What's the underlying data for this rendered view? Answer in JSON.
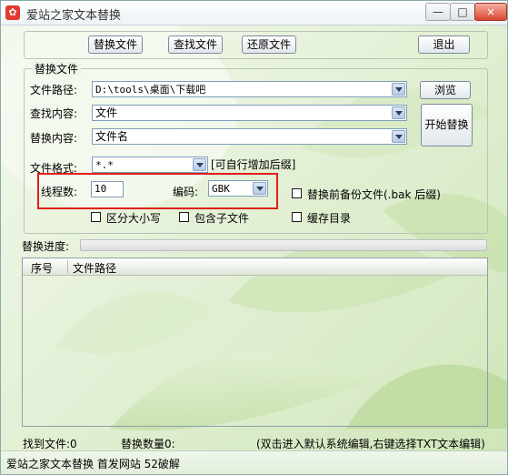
{
  "window": {
    "title": "爱站之家文本替换",
    "minimize": "—",
    "maximize": "□",
    "close": "×"
  },
  "toolbar": {
    "replace": "替换文件",
    "find": "查找文件",
    "restore": "还原文件",
    "exit": "退出"
  },
  "replace_group": {
    "legend": "替换文件",
    "path_label": "文件路径:",
    "path_value": "D:\\tools\\桌面\\下载吧",
    "browse": "浏览",
    "find_label": "查找内容:",
    "find_value": "文件",
    "replace_label": "替换内容:",
    "replace_value": "文件名",
    "start": "开始替换",
    "format_label": "文件格式:",
    "format_value": "*.*",
    "format_hint": "[可自行增加后缀]",
    "threads_label": "线程数:",
    "threads_value": "10",
    "encoding_label": "编码:",
    "encoding_value": "GBK",
    "backup_label": "替换前备份文件(.bak 后缀)",
    "case_label": "区分大小写",
    "subfolder_label": "包含子文件",
    "cache_label": "缓存目录"
  },
  "progress": {
    "label": "替换进度:",
    "value": 0
  },
  "list": {
    "col_num": "序号",
    "col_path": "文件路径"
  },
  "status": {
    "found": "找到文件:0",
    "replaced": "替换数量0:",
    "hint": "(双击进入默认系统编辑,右键选择TXT文本编辑)",
    "footer": "爱站之家文本替换 首发网站 52破解"
  },
  "colors": {
    "highlight_box": "#e0201a",
    "background": "#e9f3e2"
  }
}
